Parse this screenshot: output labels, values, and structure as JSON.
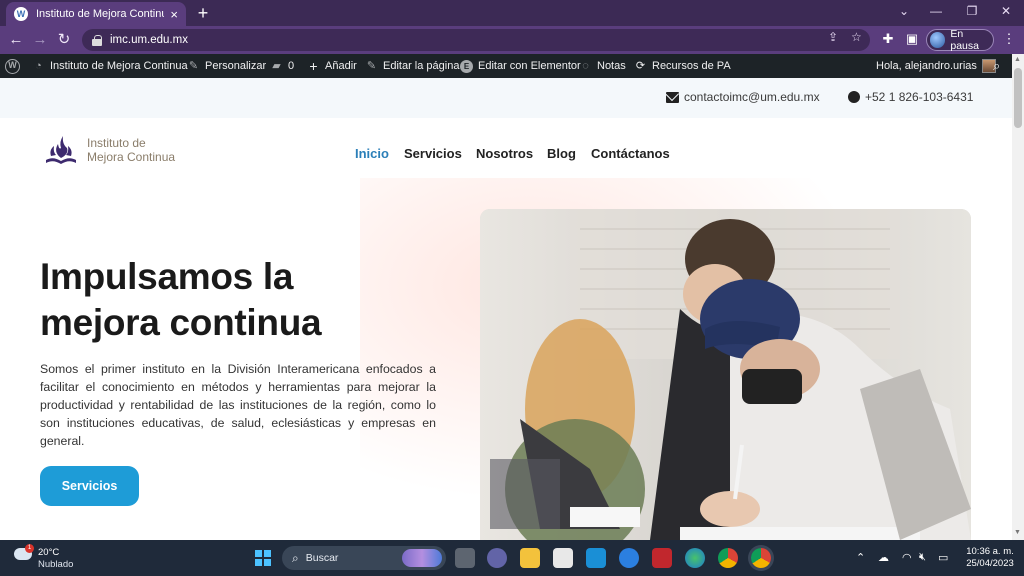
{
  "browser": {
    "tab_title": "Instituto de Mejora Continua",
    "url": "imc.um.edu.mx",
    "profile_status": "En pausa"
  },
  "admin_bar": {
    "site_name": "Instituto de Mejora Continua",
    "customize": "Personalizar",
    "comments_count": "0",
    "add": "Añadir",
    "edit_page": "Editar la página",
    "edit_elementor": "Editar con Elementor",
    "notes": "Notas",
    "resources": "Recursos de PA",
    "greeting": "Hola, alejandro.urias"
  },
  "contact_bar": {
    "email": "contactoimc@um.edu.mx",
    "phone": "+52 1 826-103-6431"
  },
  "header": {
    "logo_line1": "Instituto de",
    "logo_line2": "Mejora Continua",
    "nav": [
      "Inicio",
      "Servicios",
      "Nosotros",
      "Blog",
      "Contáctanos"
    ]
  },
  "hero": {
    "title_line1": "Impulsamos la",
    "title_line2": "mejora continua",
    "description": "Somos el primer instituto en la División Interamericana enfocados a facilitar el conocimiento en métodos y herramientas para mejorar la productividad y rentabilidad de las instituciones de la región, como lo son instituciones educativas, de salud, eclesiásticas y empresas en general.",
    "cta_label": "Servicios"
  },
  "taskbar": {
    "weather_alert_count": "1",
    "temperature": "20°C",
    "weather_condition": "Nublado",
    "search_label": "Buscar",
    "time": "10:36 a. m.",
    "date": "25/04/2023"
  },
  "colors": {
    "browser_frame": "#5a3d7d",
    "accent_blue": "#1e9cd7",
    "nav_active": "#2b7fb8",
    "whatsapp_green": "#25d366"
  }
}
